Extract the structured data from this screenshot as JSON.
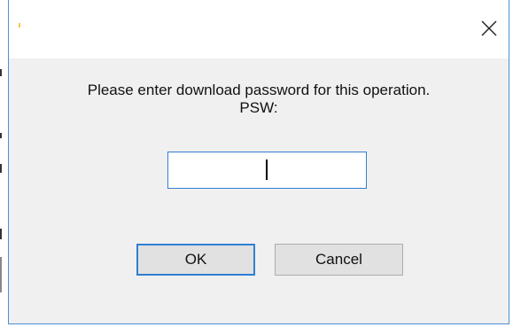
{
  "dialog": {
    "message_line1": "Please enter download password for this operation.",
    "message_line2": "PSW:",
    "password_value": "",
    "ok_label": "OK",
    "cancel_label": "Cancel",
    "close_icon": "close-icon"
  },
  "colors": {
    "window_border": "#4a90d9",
    "dialog_background": "#f0f0f0",
    "titlebar_background": "#ffffff",
    "focus_accent": "#2f7fd2",
    "button_background": "#e1e1e1"
  }
}
